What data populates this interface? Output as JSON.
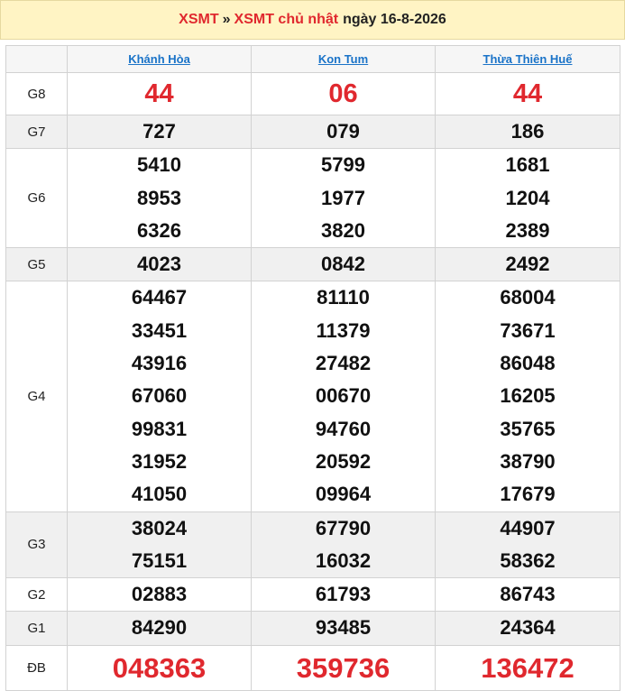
{
  "header": {
    "link1": "XSMT",
    "separator": "»",
    "link2": "XSMT chủ nhật",
    "date_text": "ngày 16-8-2026"
  },
  "provinces": [
    "Khánh Hòa",
    "Kon Tum",
    "Thừa Thiên Huế"
  ],
  "rows": [
    {
      "label": "G8",
      "values": [
        [
          "44"
        ],
        [
          "06"
        ],
        [
          "44"
        ]
      ]
    },
    {
      "label": "G7",
      "values": [
        [
          "727"
        ],
        [
          "079"
        ],
        [
          "186"
        ]
      ]
    },
    {
      "label": "G6",
      "values": [
        [
          "5410",
          "8953",
          "6326"
        ],
        [
          "5799",
          "1977",
          "3820"
        ],
        [
          "1681",
          "1204",
          "2389"
        ]
      ]
    },
    {
      "label": "G5",
      "values": [
        [
          "4023"
        ],
        [
          "0842"
        ],
        [
          "2492"
        ]
      ]
    },
    {
      "label": "G4",
      "values": [
        [
          "64467",
          "33451",
          "43916",
          "67060",
          "99831",
          "31952",
          "41050"
        ],
        [
          "81110",
          "11379",
          "27482",
          "00670",
          "94760",
          "20592",
          "09964"
        ],
        [
          "68004",
          "73671",
          "86048",
          "16205",
          "35765",
          "38790",
          "17679"
        ]
      ]
    },
    {
      "label": "G3",
      "values": [
        [
          "38024",
          "75151"
        ],
        [
          "67790",
          "16032"
        ],
        [
          "44907",
          "58362"
        ]
      ]
    },
    {
      "label": "G2",
      "values": [
        [
          "02883"
        ],
        [
          "61793"
        ],
        [
          "86743"
        ]
      ]
    },
    {
      "label": "G1",
      "values": [
        [
          "84290"
        ],
        [
          "93485"
        ],
        [
          "24364"
        ]
      ]
    },
    {
      "label": "ĐB",
      "values": [
        [
          "048363"
        ],
        [
          "359736"
        ],
        [
          "136472"
        ]
      ]
    }
  ],
  "colors": {
    "highlight": "#e0282e",
    "link": "#1a73c8",
    "header_bg": "#fff4c4",
    "alt_row": "#f0f0f0"
  }
}
